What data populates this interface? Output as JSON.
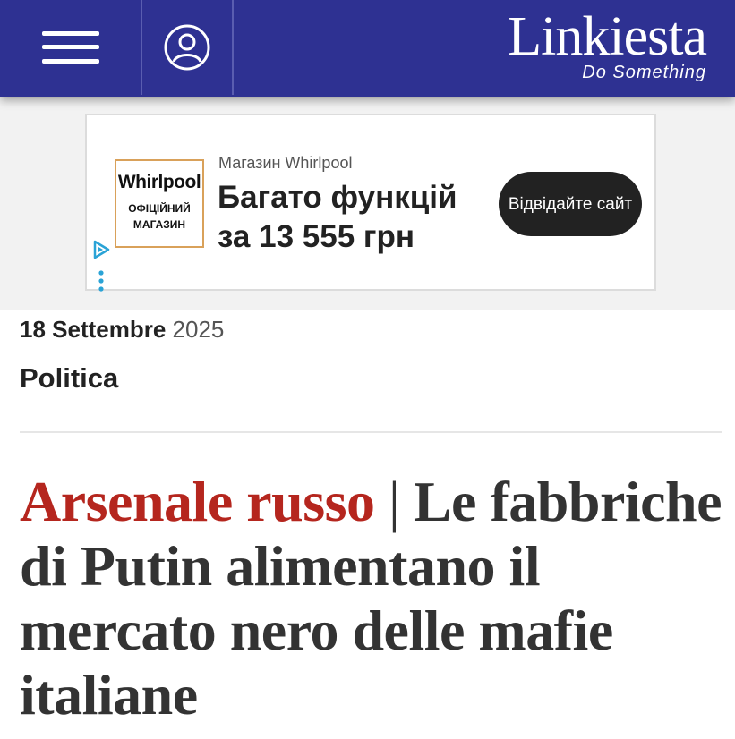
{
  "header": {
    "logo_text": "Linkiesta",
    "tagline": "Do Something",
    "menu_icon": "hamburger-menu-icon",
    "account_icon": "user-account-icon",
    "background_color": "#2e3192"
  },
  "ad": {
    "logo_brand": "Whirlpool",
    "logo_sub_line1": "ОФІЦІЙНИЙ",
    "logo_sub_line2": "МАГАЗИН",
    "store_label": "Магазин Whirlpool",
    "headline": "Багато функцій за 13 555 грн",
    "cta_label": "Відвідайте сайт",
    "adchoices_icon": "adchoices-icon",
    "more_icon": "more-options-icon"
  },
  "article": {
    "date_day_month": "18 Settembre",
    "date_year": "2025",
    "category": "Politica",
    "kicker": "Arsenale russo",
    "separator": "|",
    "title": "Le fabbriche di Putin alimentano il mercato nero delle mafie italiane",
    "kicker_color": "#b5261e"
  }
}
